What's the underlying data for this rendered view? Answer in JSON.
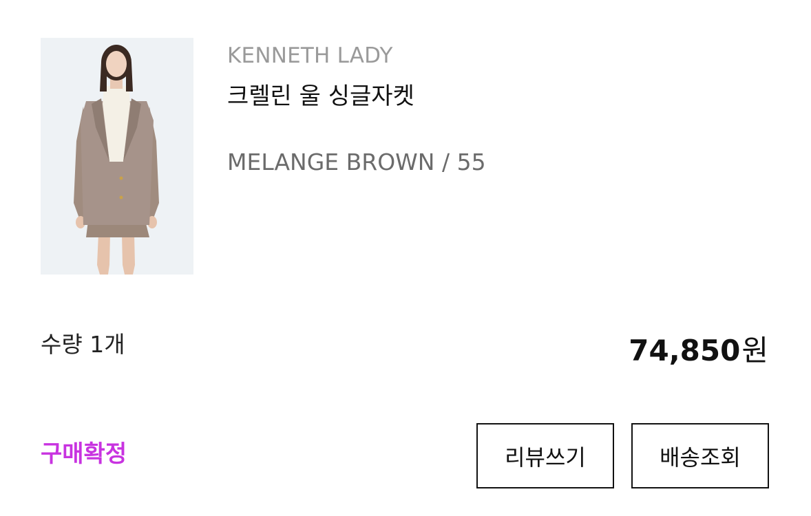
{
  "order_item": {
    "brand": "KENNETH LADY",
    "product_name": "크렐린 울 싱글자켓",
    "option": "MELANGE BROWN / 55",
    "quantity_label": "수량 1개",
    "price_value": "74,850",
    "price_unit": "원",
    "status": "구매확정",
    "thumbnail_alt": "크렐린 울 싱글자켓"
  },
  "actions": {
    "review_label": "리뷰쓰기",
    "shipping_label": "배송조회"
  },
  "colors": {
    "status_accent": "#c833e0",
    "brand_text": "#9a9a9a",
    "option_text": "#6b6b6b",
    "button_border": "#111111"
  }
}
